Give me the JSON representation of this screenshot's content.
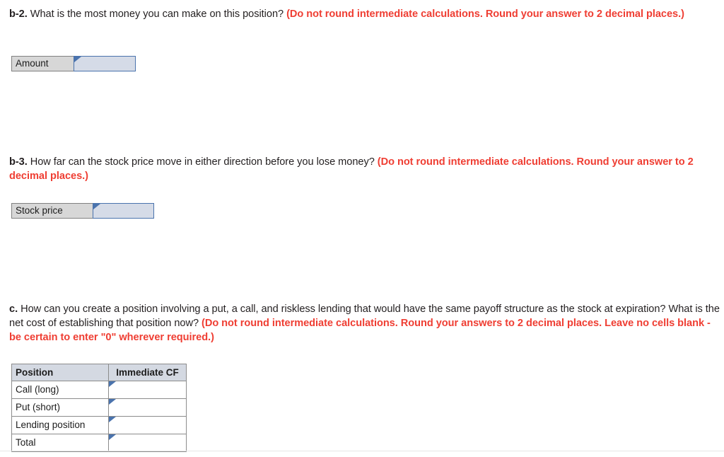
{
  "questions": {
    "b2": {
      "label": "b-2.",
      "text": " What is the most money you can make on this position? ",
      "note": "(Do not round intermediate calculations. Round your answer to 2 decimal places.)"
    },
    "b3": {
      "label": "b-3.",
      "text": " How far can the stock price move in either direction before you lose money? ",
      "note": "(Do not round intermediate calculations. Round your answer to 2 decimal places.)"
    },
    "c": {
      "label": "c.",
      "text": " How can you create a position involving a put, a call, and riskless lending that would have the same payoff structure as the stock at expiration? What is the net cost of establishing that position now? ",
      "note": "(Do not round intermediate calculations. Round your answers to 2 decimal places. Leave no cells blank - be certain to enter \"0\" wherever required.)"
    }
  },
  "answers": {
    "amount": {
      "label": "Amount",
      "value": "",
      "placeholder": ""
    },
    "stock_price": {
      "label": "Stock price",
      "value": "",
      "placeholder": ""
    }
  },
  "position_table": {
    "headers": [
      "Position",
      "Immediate CF"
    ],
    "rows": [
      {
        "position": "Call (long)",
        "immediate_cf": ""
      },
      {
        "position": "Put (short)",
        "immediate_cf": ""
      },
      {
        "position": "Lending position",
        "immediate_cf": ""
      },
      {
        "position": "Total",
        "immediate_cf": ""
      }
    ]
  },
  "colors": {
    "red_note": "#ef3e33",
    "input_border": "#4a73ad",
    "input_fill": "#d5dbe7",
    "label_fill": "#d7d7d7",
    "header_fill": "#d4d9e2",
    "total_border": "#12264a"
  }
}
